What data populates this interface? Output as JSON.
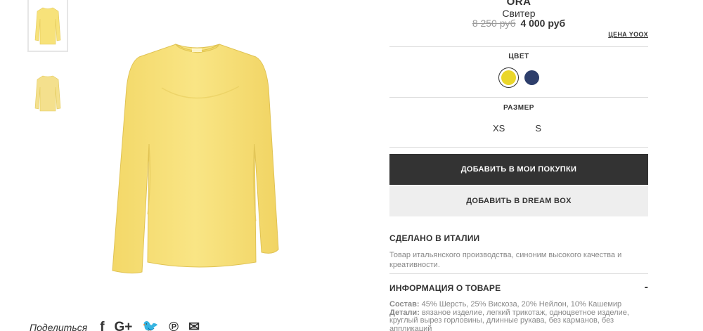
{
  "product": {
    "brand": "ORA",
    "type": "Свитер",
    "old_price": "8 250 руб",
    "new_price": "4 000 руб",
    "yoox_price_label": "ЦЕНА YOOX"
  },
  "color": {
    "title": "ЦВЕТ",
    "options": [
      {
        "name": "yellow",
        "hex": "#ead62a",
        "selected": true
      },
      {
        "name": "navy",
        "hex": "#2d3e6b",
        "selected": false
      }
    ]
  },
  "size": {
    "title": "РАЗМЕР",
    "options": [
      "XS",
      "S"
    ]
  },
  "buttons": {
    "add_to_cart": "ДОБАВИТЬ В МОИ ПОКУПКИ",
    "add_to_dreambox": "ДОБАВИТЬ В DREAM BOX"
  },
  "made_in": {
    "title": "СДЕЛАНО В ИТАЛИИ",
    "text": "Товар итальянского производства, синоним высокого качества и креативности."
  },
  "info": {
    "title": "ИНФОРМАЦИЯ О ТОВАРЕ",
    "toggle": "-",
    "composition_label": "Состав:",
    "composition": "45% Шерсть, 25% Вискоза, 20% Нейлон, 10% Кашемир",
    "details_label": "Детали:",
    "details": "вязаное изделие, легкий трикотаж, одноцветное изделие, круглый вырез горловины, длинные рукава, без карманов, без аппликаций"
  },
  "share": {
    "label": "Поделиться",
    "icons": [
      "facebook-icon",
      "google-plus-icon",
      "twitter-icon",
      "pinterest-icon",
      "email-icon"
    ],
    "glyphs": [
      "f",
      "G+",
      "🐦",
      "℗",
      "✉"
    ]
  },
  "colors": {
    "sweater": "#f7e27a",
    "sweater_shade": "#e8cf5e",
    "dark": "#333333"
  }
}
